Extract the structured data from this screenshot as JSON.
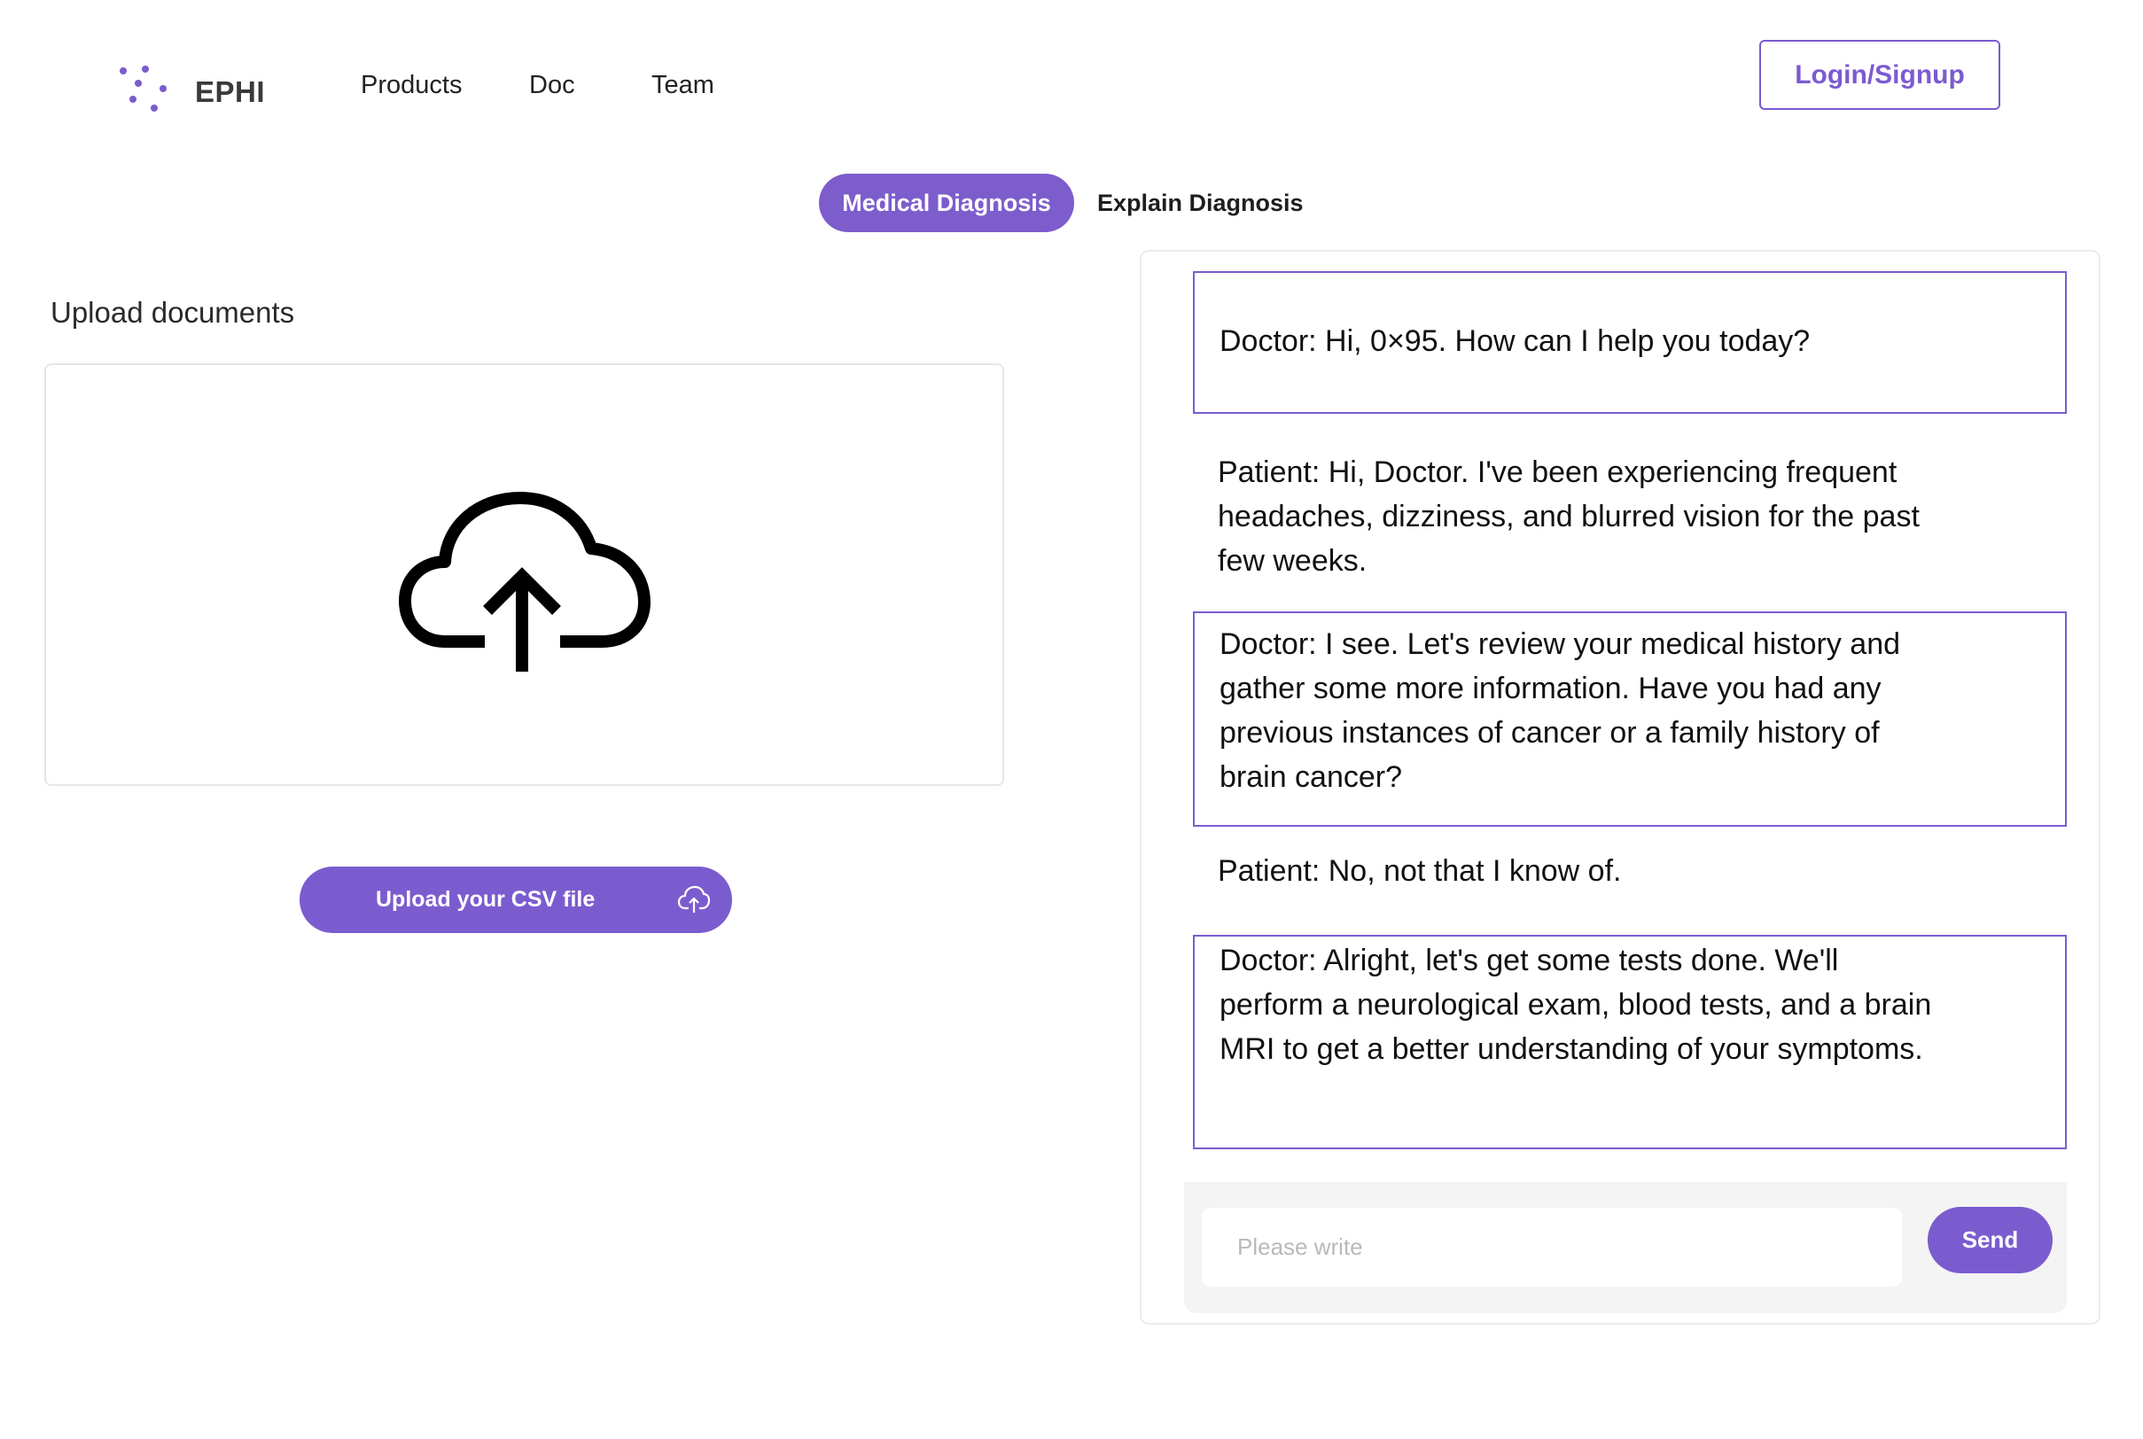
{
  "header": {
    "brand": "EPHI",
    "nav": [
      "Products",
      "Doc",
      "Team"
    ],
    "login_label": "Login/Signup"
  },
  "tabs": [
    {
      "label": "Medical Diagnosis",
      "active": true
    },
    {
      "label": "Explain Diagnosis",
      "active": false
    }
  ],
  "upload": {
    "title": "Upload documents",
    "dropzone_icon": "cloud-upload-icon",
    "csv_button_label": "Upload your CSV file",
    "csv_button_icon": "cloud-upload-icon"
  },
  "chat": {
    "messages": [
      {
        "role": "doctor",
        "text": "Doctor: Hi, 0×95. How can I help you today?"
      },
      {
        "role": "patient",
        "text": "Patient: Hi, Doctor. I've been experiencing frequent headaches, dizziness, and blurred vision for the past few weeks."
      },
      {
        "role": "doctor",
        "text": "Doctor: I see. Let's review your medical history and gather some more information. Have you had any previous instances of cancer or a family history of brain cancer?"
      },
      {
        "role": "patient",
        "text": "Patient: No, not that I know of."
      },
      {
        "role": "doctor",
        "text": "Doctor: Alright, let's get some tests done. We'll perform a neurological exam, blood tests, and a brain MRI to get a better understanding of your symptoms."
      }
    ],
    "input_value": "",
    "input_placeholder": "Please write",
    "send_label": "Send"
  },
  "colors": {
    "accent": "#7b5ccf",
    "accent_text": "#7a5bd0",
    "panel_border": "#ececec",
    "composer_bg": "#f4f4f4"
  }
}
